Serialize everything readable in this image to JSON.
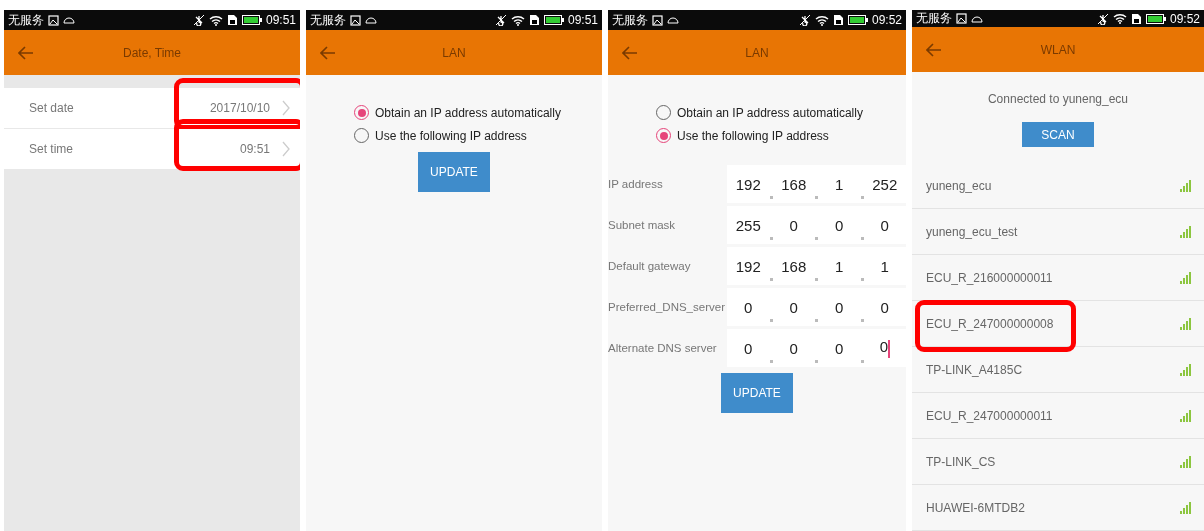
{
  "screens": [
    {
      "kind": "datetime",
      "status_bar": {
        "carrier": "无服务",
        "time": "09:51"
      },
      "header": {
        "title": "Date, Time"
      },
      "rows": [
        {
          "label": "Set date",
          "value": "2017/10/10",
          "highlighted": true
        },
        {
          "label": "Set time",
          "value": "09:51",
          "highlighted": true
        }
      ]
    },
    {
      "kind": "lan",
      "status_bar": {
        "carrier": "无服务",
        "time": "09:51"
      },
      "header": {
        "title": "LAN"
      },
      "radios": [
        {
          "label": "Obtain an IP address automatically",
          "selected": true
        },
        {
          "label": "Use the following IP address",
          "selected": false
        }
      ],
      "button": "UPDATE"
    },
    {
      "kind": "lan",
      "status_bar": {
        "carrier": "无服务",
        "time": "09:52"
      },
      "header": {
        "title": "LAN"
      },
      "radios": [
        {
          "label": "Obtain an IP address automatically",
          "selected": false
        },
        {
          "label": "Use the following IP address",
          "selected": true
        }
      ],
      "fields": [
        {
          "label": "IP address",
          "octets": [
            "192",
            "168",
            "1",
            "252"
          ],
          "focused": false
        },
        {
          "label": "Subnet mask",
          "octets": [
            "255",
            "0",
            "0",
            "0"
          ],
          "focused": false
        },
        {
          "label": "Default gateway",
          "octets": [
            "192",
            "168",
            "1",
            "1"
          ],
          "focused": false
        },
        {
          "label": "Preferred_DNS_server",
          "octets": [
            "0",
            "0",
            "0",
            "0"
          ],
          "focused": false
        },
        {
          "label": "Alternate DNS server",
          "octets": [
            "0",
            "0",
            "0",
            "0"
          ],
          "focused": true
        }
      ],
      "button": "UPDATE"
    },
    {
      "kind": "wlan",
      "status_bar": {
        "carrier": "无服务",
        "time": "09:52"
      },
      "header": {
        "title": "WLAN"
      },
      "connected": "Connected to yuneng_ecu",
      "button": "SCAN",
      "networks": [
        {
          "name": "yuneng_ecu",
          "highlighted": false
        },
        {
          "name": "yuneng_ecu_test",
          "highlighted": false
        },
        {
          "name": "ECU_R_216000000011",
          "highlighted": false
        },
        {
          "name": "ECU_R_247000000008",
          "highlighted": true
        },
        {
          "name": "TP-LINK_A4185C",
          "highlighted": false
        },
        {
          "name": "ECU_R_247000000011",
          "highlighted": false
        },
        {
          "name": "TP-LINK_CS",
          "highlighted": false
        },
        {
          "name": "HUAWEI-6MTDB2",
          "highlighted": false
        }
      ]
    }
  ]
}
